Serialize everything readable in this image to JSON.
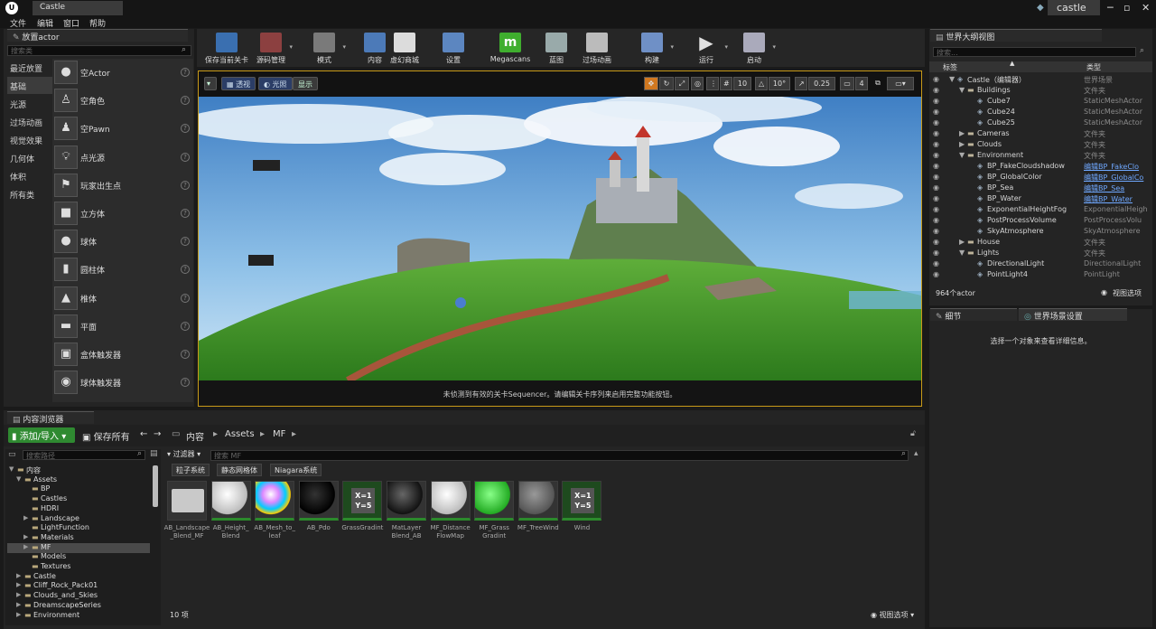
{
  "title_bar": {
    "tab": "Castle",
    "project": "castle"
  },
  "menu": [
    "文件",
    "编辑",
    "窗口",
    "帮助"
  ],
  "place_panel": {
    "tab": "放置actor",
    "search_placeholder": "搜索类",
    "categories": [
      "最近放置",
      "基础",
      "光源",
      "过场动画",
      "视觉效果",
      "几何体",
      "体积",
      "所有类"
    ],
    "items": [
      "空Actor",
      "空角色",
      "空Pawn",
      "点光源",
      "玩家出生点",
      "立方体",
      "球体",
      "圆柱体",
      "椎体",
      "平面",
      "盒体触发器",
      "球体触发器"
    ]
  },
  "toolbar": [
    {
      "label": "保存当前关卡",
      "icon": "save-icon"
    },
    {
      "label": "源码管理",
      "icon": "source-control-icon"
    },
    {
      "label": "模式",
      "icon": "modes-icon"
    },
    {
      "label": "内容",
      "icon": "content-icon"
    },
    {
      "label": "虚幻商城",
      "icon": "marketplace-icon"
    },
    {
      "label": "设置",
      "icon": "settings-icon"
    },
    {
      "label": "Megascans",
      "icon": "megascans-icon"
    },
    {
      "label": "蓝图",
      "icon": "blueprint-icon"
    },
    {
      "label": "过场动画",
      "icon": "cinematics-icon"
    },
    {
      "label": "构建",
      "icon": "build-icon"
    },
    {
      "label": "运行",
      "icon": "play-icon"
    },
    {
      "label": "启动",
      "icon": "launch-icon"
    }
  ],
  "viewport": {
    "perspective": "透视",
    "lit": "光照",
    "show": "显示",
    "grid_snap": "10",
    "rot_snap": "10°",
    "scale_snap": "0.25",
    "camera_speed": "4",
    "sequencer_msg": "未侦测到有效的关卡Sequencer。请编辑关卡序列来启用完整功能按钮。"
  },
  "outliner": {
    "tab": "世界大纲视图",
    "search_placeholder": "搜索...",
    "col_label": "标签",
    "col_type": "类型",
    "rows": [
      {
        "name": "Castle（编辑器）",
        "type": "世界场景",
        "indent": 0,
        "arrow": "▼",
        "link": false
      },
      {
        "name": "Buildings",
        "type": "文件夹",
        "indent": 1,
        "arrow": "▼",
        "link": false
      },
      {
        "name": "Cube7",
        "type": "StaticMeshActor",
        "indent": 2,
        "arrow": "",
        "link": false
      },
      {
        "name": "Cube24",
        "type": "StaticMeshActor",
        "indent": 2,
        "arrow": "",
        "link": false
      },
      {
        "name": "Cube25",
        "type": "StaticMeshActor",
        "indent": 2,
        "arrow": "",
        "link": false
      },
      {
        "name": "Cameras",
        "type": "文件夹",
        "indent": 1,
        "arrow": "▶",
        "link": false
      },
      {
        "name": "Clouds",
        "type": "文件夹",
        "indent": 1,
        "arrow": "▶",
        "link": false
      },
      {
        "name": "Environment",
        "type": "文件夹",
        "indent": 1,
        "arrow": "▼",
        "link": false
      },
      {
        "name": "BP_FakeCloudshadow",
        "type": "编辑BP_FakeClo",
        "indent": 2,
        "arrow": "",
        "link": true
      },
      {
        "name": "BP_GlobalColor",
        "type": "编辑BP_GlobalCo",
        "indent": 2,
        "arrow": "",
        "link": true
      },
      {
        "name": "BP_Sea",
        "type": "编辑BP_Sea",
        "indent": 2,
        "arrow": "",
        "link": true
      },
      {
        "name": "BP_Water",
        "type": "编辑BP_Water",
        "indent": 2,
        "arrow": "",
        "link": true
      },
      {
        "name": "ExponentialHeightFog",
        "type": "ExponentialHeigh",
        "indent": 2,
        "arrow": "",
        "link": false
      },
      {
        "name": "PostProcessVolume",
        "type": "PostProcessVolu",
        "indent": 2,
        "arrow": "",
        "link": false
      },
      {
        "name": "SkyAtmosphere",
        "type": "SkyAtmosphere",
        "indent": 2,
        "arrow": "",
        "link": false
      },
      {
        "name": "House",
        "type": "文件夹",
        "indent": 1,
        "arrow": "▶",
        "link": false
      },
      {
        "name": "Lights",
        "type": "文件夹",
        "indent": 1,
        "arrow": "▼",
        "link": false
      },
      {
        "name": "DirectionalLight",
        "type": "DirectionalLight",
        "indent": 2,
        "arrow": "",
        "link": false
      },
      {
        "name": "PointLight4",
        "type": "PointLight",
        "indent": 2,
        "arrow": "",
        "link": false
      }
    ],
    "actor_count": "964个actor",
    "view_options": "视图选项"
  },
  "details": {
    "tab_details": "细节",
    "tab_world": "世界场景设置",
    "empty_msg": "选择一个对象来查看详细信息。"
  },
  "content_browser": {
    "tab": "内容浏览器",
    "add_import": "添加/导入",
    "save_all": "保存所有",
    "breadcrumb": [
      "内容",
      "Assets",
      "MF"
    ],
    "path_search_placeholder": "搜索路径",
    "filter_label": "过滤器",
    "asset_search_placeholder": "搜索 MF",
    "chips": [
      "粒子系统",
      "静态网格体",
      "Niagara系统"
    ],
    "tree": [
      {
        "label": "内容",
        "indent": 0,
        "arrow": "▼",
        "sel": false
      },
      {
        "label": "Assets",
        "indent": 1,
        "arrow": "▼",
        "sel": false
      },
      {
        "label": "BP",
        "indent": 2,
        "arrow": "",
        "sel": false
      },
      {
        "label": "Castles",
        "indent": 2,
        "arrow": "",
        "sel": false
      },
      {
        "label": "HDRI",
        "indent": 2,
        "arrow": "",
        "sel": false
      },
      {
        "label": "Landscape",
        "indent": 2,
        "arrow": "▶",
        "sel": false
      },
      {
        "label": "LightFunction",
        "indent": 2,
        "arrow": "",
        "sel": false
      },
      {
        "label": "Materials",
        "indent": 2,
        "arrow": "▶",
        "sel": false
      },
      {
        "label": "MF",
        "indent": 2,
        "arrow": "▶",
        "sel": true
      },
      {
        "label": "Models",
        "indent": 2,
        "arrow": "",
        "sel": false
      },
      {
        "label": "Textures",
        "indent": 2,
        "arrow": "",
        "sel": false
      },
      {
        "label": "Castle",
        "indent": 1,
        "arrow": "▶",
        "sel": false
      },
      {
        "label": "Cliff_Rock_Pack01",
        "indent": 1,
        "arrow": "▶",
        "sel": false
      },
      {
        "label": "Clouds_and_Skies",
        "indent": 1,
        "arrow": "▶",
        "sel": false
      },
      {
        "label": "DreamscapeSeries",
        "indent": 1,
        "arrow": "▶",
        "sel": false
      },
      {
        "label": "Environment",
        "indent": 1,
        "arrow": "▶",
        "sel": false
      }
    ],
    "assets": [
      {
        "label": "AB_Landscape\n_Blend_MF",
        "kind": "folder"
      },
      {
        "label": "AB_Height_\nBlend",
        "kind": "white"
      },
      {
        "label": "AB_Mesh_to_\nleaf",
        "kind": "rainbow"
      },
      {
        "label": "AB_Pdo",
        "kind": "black"
      },
      {
        "label": "GrassGradint",
        "kind": "xy"
      },
      {
        "label": "MatLayer\nBlend_AB",
        "kind": "darkball"
      },
      {
        "label": "MF_Distance\nFlowMap",
        "kind": "white"
      },
      {
        "label": "MF_Grass\nGradint",
        "kind": "green"
      },
      {
        "label": "MF_TreeWind",
        "kind": "checker"
      },
      {
        "label": "Wind",
        "kind": "xy"
      }
    ],
    "item_count": "10 项",
    "view_options": "视图选项"
  }
}
